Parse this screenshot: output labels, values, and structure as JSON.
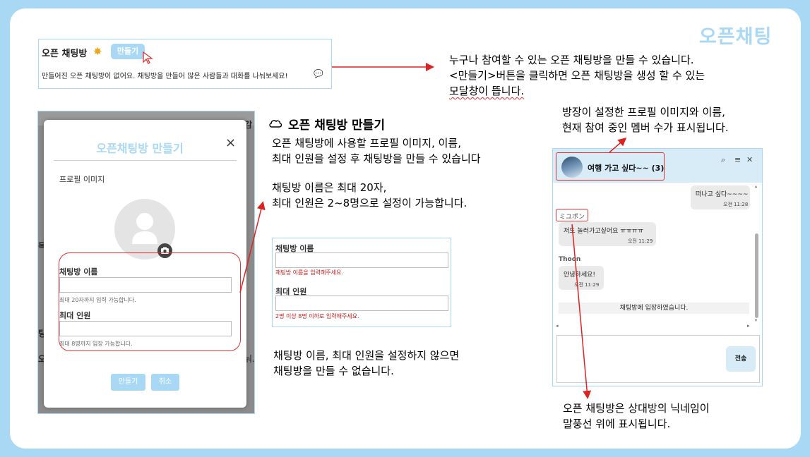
{
  "corner_title": "오픈채팅",
  "banner": {
    "title": "오픈 채팅방",
    "sparkle_icon": "sparkle-icon",
    "create_button": "만들기",
    "empty_text": "만들어진 오픈 채팅방이 없어요. 채팅방을 만들어 많은 사람들과 대화를 나눠보세요!"
  },
  "top_desc": {
    "line1": "누구나 참여할 수 있는 오픈 채팅방을 만들 수 있습니다.",
    "line2": "<만들기>버튼을 클릭하면 오픈 채팅방을 생성 할 수 있는",
    "line3": "모달창이 뜹니다."
  },
  "modal_bg": {
    "frag1": "감",
    "frag2": "독",
    "frag3": "팅",
    "frag4": "오",
    "frag5": "눠."
  },
  "modal": {
    "title": "오픈채팅방 만들기",
    "close": "×",
    "profile_label": "프로필 이미지",
    "name_label": "채팅방 이름",
    "name_hint": "최대 20자까지 입력 가능합니다.",
    "max_label": "최대 인원",
    "max_hint": "최대 8명까지 입장 가능합니다.",
    "create_button": "만들기",
    "cancel_button": "취소"
  },
  "section": {
    "title": "오픈 채팅방 만들기",
    "p1_line1": "오픈 채팅방에 사용할 프로필 이미지, 이름,",
    "p1_line2": "최대 인원을 설정 후 채팅방을 만들 수 있습니다",
    "p2_line1": "채팅방 이름은 최대 20자,",
    "p2_line2": "최대 인원은 2~8명으로 설정이 가능합니다.",
    "p3_line1": "채팅방 이름, 최대 인원을 설정하지 않으면",
    "p3_line2": "채팅방을 만들 수 없습니다."
  },
  "validation": {
    "name_label": "채팅방 이름",
    "name_error": "채팅방 이름을 입력해주세요.",
    "max_label": "최대 인원",
    "max_error": "2명 이상 8명 이하로 입력해주세요."
  },
  "chat_desc_top": {
    "line1": "방장이 설정한 프로필 이미지와 이름,",
    "line2": "현재 참여 중인 멤버 수가 표시됩니다."
  },
  "chat": {
    "room_title": "여행 가고 싶다~~ (3)",
    "msg1": "떠나고 싶다~~~~",
    "msg1_time": "오전 11:28",
    "nick1": "ミユポン",
    "msg2": "저도 놀러가고싶어요 ㅠㅠㅠㅠ",
    "msg2_time": "오전 11:29",
    "nick2": "Thoon",
    "msg3": "안녕하세요!",
    "msg3_time": "오전 11:29",
    "system_msg": "채팅방에 입장하였습니다.",
    "send_button": "전송"
  },
  "chat_desc_bottom": {
    "line1": "오픈 채팅방은 상대방의 닉네임이",
    "line2": "말풍선 위에 표시됩니다."
  },
  "colors": {
    "accent": "#a9d8f5",
    "annotation": "#dd2222",
    "error": "#d01818"
  }
}
